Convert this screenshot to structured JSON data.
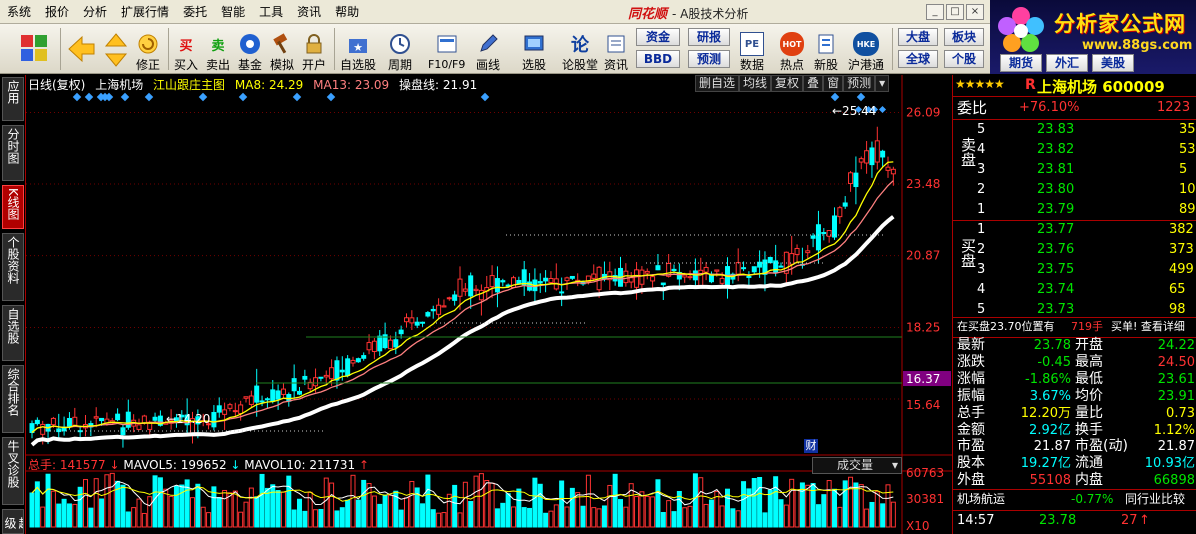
{
  "menu": [
    "系统",
    "报价",
    "分析",
    "扩展行情",
    "委托",
    "智能",
    "工具",
    "资讯",
    "帮助"
  ],
  "brand": "同花顺",
  "window_title": "- A股技术分析",
  "logo": {
    "title": "分析家公式网",
    "url_text": "www.88gs.com"
  },
  "toolbar": {
    "buttons": [
      {
        "label": "",
        "icon": "grid-icon"
      },
      {
        "label": "",
        "icon": "arrow-left-icon"
      },
      {
        "label": "修正",
        "icon": "refresh-icon"
      },
      {
        "label": "买入",
        "glyph": "买"
      },
      {
        "label": "卖出",
        "glyph": "卖"
      },
      {
        "label": "基金",
        "icon": "fund-icon"
      },
      {
        "label": "模拟",
        "icon": "hammer-icon"
      },
      {
        "label": "开户",
        "icon": "lock-icon"
      },
      {
        "label": "自选股",
        "icon": "star-folder-icon"
      },
      {
        "label": "周期",
        "icon": "clock-icon"
      },
      {
        "label": "F10/F9",
        "icon": "document-icon"
      },
      {
        "label": "画线",
        "icon": "pencil-icon"
      },
      {
        "label": "选股",
        "icon": "screen-icon"
      },
      {
        "label": "论股堂",
        "glyph": "论"
      },
      {
        "label": "资讯",
        "icon": "news-icon"
      },
      {
        "label": "数据",
        "glyph": "PE"
      },
      {
        "label": "热点",
        "glyph": "HOT"
      },
      {
        "label": "新股",
        "icon": "newstock-icon"
      },
      {
        "label": "沪港通",
        "glyph": "HKE"
      }
    ],
    "small": {
      "zijin": "资金",
      "bbd": "BBD",
      "yanbao": "研报",
      "yuce": "预测",
      "dapan": "大盘",
      "bankuai": "板块",
      "quanqiu": "全球",
      "quanpan": "个股",
      "qihuo": "期货",
      "waihui": "外汇",
      "meigu": "美股"
    }
  },
  "left_tabs": [
    "应用",
    "分时图",
    "K线图",
    "个股资料",
    "自选股",
    "综合排名",
    "牛叉诊股",
    "超级"
  ],
  "chart": {
    "period_label": "日线(复权)",
    "stock": "上海机场",
    "indicator": "江山跟庄主图",
    "ma8": "MA8: 24.29",
    "ma13": "MA13: 23.09",
    "caopan": "操盘线: 21.91",
    "buttons": [
      "删自选",
      "均线",
      "复权",
      "叠",
      "窗",
      "预测"
    ],
    "price_axis": [
      "26.09",
      "23.48",
      "20.87",
      "18.25",
      "16.37",
      "15.64"
    ],
    "high_label": "25.44",
    "low_label": "14.20",
    "cai": "财",
    "vol_total": "总手: 141577",
    "mavol5": "MAVOL5: 199652",
    "mavol10": "MAVOL10: 211731",
    "vol_axis": [
      "60763",
      "30381",
      "X10"
    ],
    "vol_select": "成交量"
  },
  "quote": {
    "stars": "★★★★★",
    "r": "R",
    "name": "上海机场",
    "code": "600009",
    "weibi_label": "委比",
    "weibi_value": "+76.10%",
    "weicha": "1223",
    "sell_label": "卖盘",
    "buy_label": "买盘",
    "sell": [
      {
        "lvl": "5",
        "price": "23.83",
        "vol": "35"
      },
      {
        "lvl": "4",
        "price": "23.82",
        "vol": "53"
      },
      {
        "lvl": "3",
        "price": "23.81",
        "vol": "5"
      },
      {
        "lvl": "2",
        "price": "23.80",
        "vol": "10"
      },
      {
        "lvl": "1",
        "price": "23.79",
        "vol": "89"
      }
    ],
    "buy": [
      {
        "lvl": "1",
        "price": "23.77",
        "vol": "382"
      },
      {
        "lvl": "2",
        "price": "23.76",
        "vol": "373"
      },
      {
        "lvl": "3",
        "price": "23.75",
        "vol": "499"
      },
      {
        "lvl": "4",
        "price": "23.74",
        "vol": "65"
      },
      {
        "lvl": "5",
        "price": "23.73",
        "vol": "98"
      }
    ],
    "notice": "在买盘23.70位置有",
    "notice_vol": "719手",
    "notice_link": "买单! 查看详细",
    "stats": [
      {
        "l1": "最新",
        "v1": "23.78",
        "c1": "green",
        "l2": "开盘",
        "v2": "24.22",
        "c2": "green"
      },
      {
        "l1": "涨跌",
        "v1": "-0.45",
        "c1": "green",
        "l2": "最高",
        "v2": "24.50",
        "c2": "red"
      },
      {
        "l1": "涨幅",
        "v1": "-1.86%",
        "c1": "green",
        "l2": "最低",
        "v2": "23.61",
        "c2": "green"
      },
      {
        "l1": "振幅",
        "v1": "3.67%",
        "c1": "cyan",
        "l2": "均价",
        "v2": "23.91",
        "c2": "green"
      },
      {
        "l1": "总手",
        "v1": "12.20万",
        "c1": "yellow",
        "l2": "量比",
        "v2": "0.73",
        "c2": "yellow"
      },
      {
        "l1": "金额",
        "v1": "2.92亿",
        "c1": "cyan",
        "l2": "换手",
        "v2": "1.12%",
        "c2": "yellow"
      },
      {
        "l1": "市盈",
        "v1": "21.87",
        "c1": "white",
        "l2": "市盈(动)",
        "v2": "21.87",
        "c2": "white"
      },
      {
        "l1": "股本",
        "v1": "19.27亿",
        "c1": "cyan",
        "l2": "流通",
        "v2": "10.93亿",
        "c2": "cyan"
      },
      {
        "l1": "外盘",
        "v1": "55108",
        "c1": "red",
        "l2": "内盘",
        "v2": "66898",
        "c2": "green"
      }
    ],
    "sector_name": "机场航运",
    "sector_change": "-0.77%",
    "sector_compare": "同行业比较",
    "tick_time": "14:57",
    "tick_price": "23.78",
    "tick_vol": "27"
  },
  "colors": {
    "up": "#ff3232",
    "down": "#00ffff",
    "ma8": "#ffff00",
    "ma13": "#ff8080",
    "caopan": "#ffffff",
    "border": "#aa0000"
  }
}
